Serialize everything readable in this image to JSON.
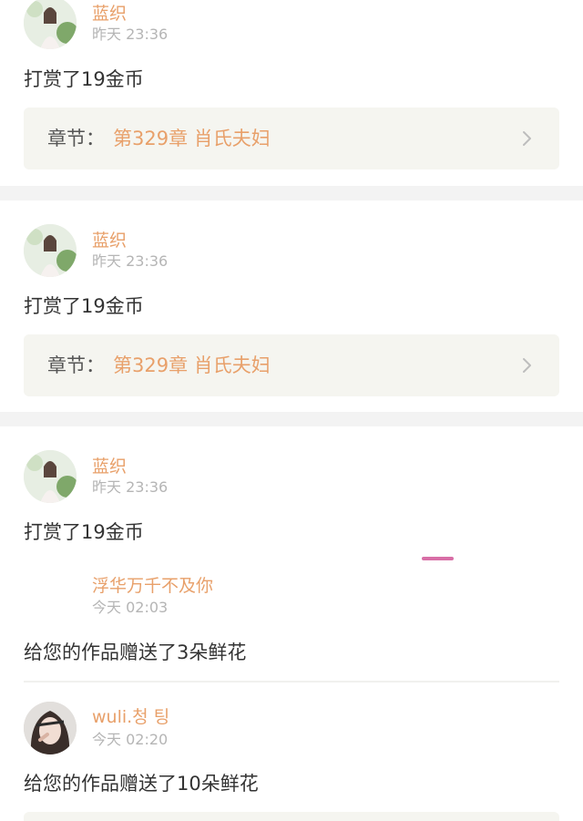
{
  "posts": [
    {
      "user": "蓝织",
      "time": "昨天 23:36",
      "message": "打赏了19金币",
      "chapter_label": "章节：",
      "chapter_title": "第329章 肖氏夫妇"
    },
    {
      "user": "蓝织",
      "time": "昨天 23:36",
      "message": "打赏了19金币",
      "chapter_label": "章节：",
      "chapter_title": "第329章 肖氏夫妇"
    },
    {
      "user": "蓝织",
      "time": "昨天 23:36",
      "message": "打赏了19金币",
      "replies": [
        {
          "user": "浮华万千不及你",
          "time": "今天 02:03",
          "message": "给您的作品赠送了3朵鲜花"
        },
        {
          "user": "wuli.청 팅",
          "time": "今天 02:20",
          "message": "给您的作品赠送了10朵鲜花"
        }
      ]
    }
  ],
  "colors": {
    "username": "#e8a06a",
    "timestamp": "#b5b5b5",
    "text": "#333333",
    "chapter_bg": "#f5f5f0",
    "separator": "#f3f3f3",
    "accent_pink": "#d86ea6"
  }
}
